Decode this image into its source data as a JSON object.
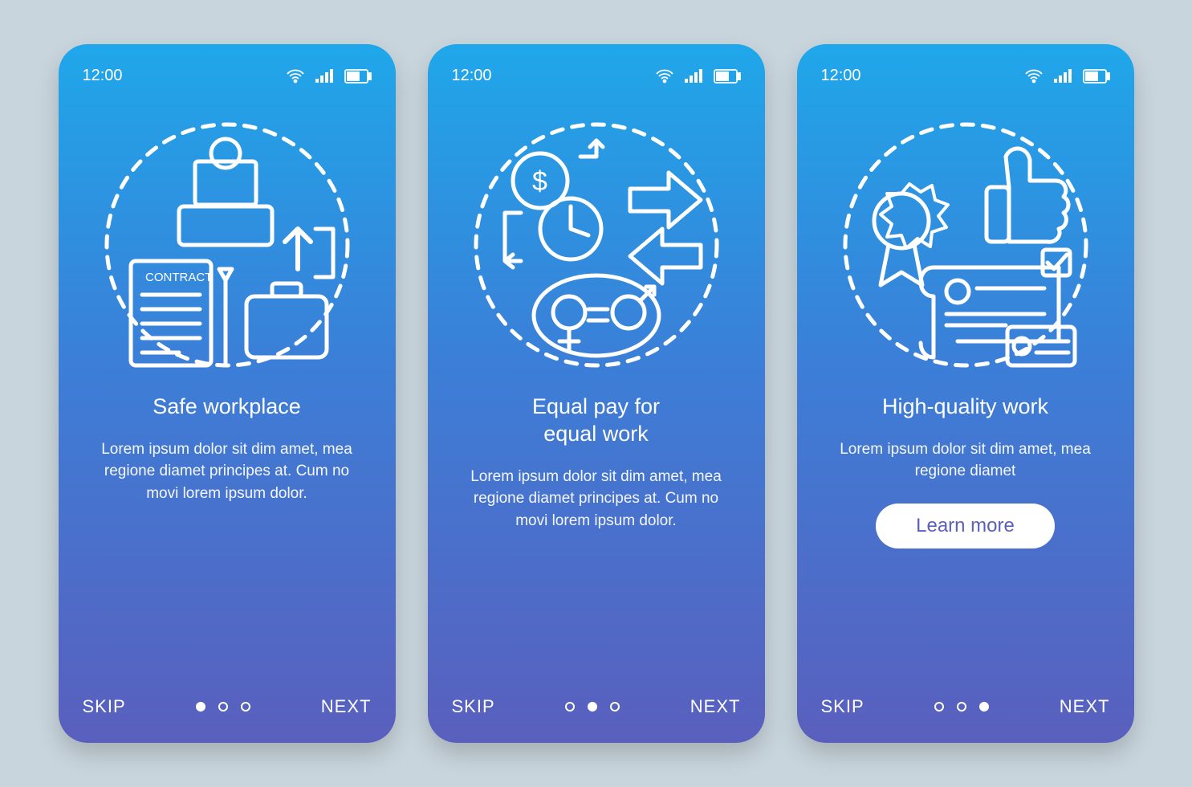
{
  "status": {
    "time": "12:00"
  },
  "nav": {
    "skip": "SKIP",
    "next": "NEXT"
  },
  "screens": [
    {
      "title": "Safe workplace",
      "desc": "Lorem ipsum dolor sit dim amet, mea regione diamet principes at. Cum no movi lorem ipsum dolor.",
      "activeDot": 0,
      "learnMore": null,
      "iconLabel": "CONTRACT"
    },
    {
      "title": "Equal pay for\nequal work",
      "desc": "Lorem ipsum dolor sit dim amet, mea regione diamet principes at. Cum no movi lorem ipsum dolor.",
      "activeDot": 1,
      "learnMore": null
    },
    {
      "title": "High-quality work",
      "desc": "Lorem ipsum dolor sit dim amet, mea regione diamet",
      "activeDot": 2,
      "learnMore": "Learn more"
    }
  ]
}
